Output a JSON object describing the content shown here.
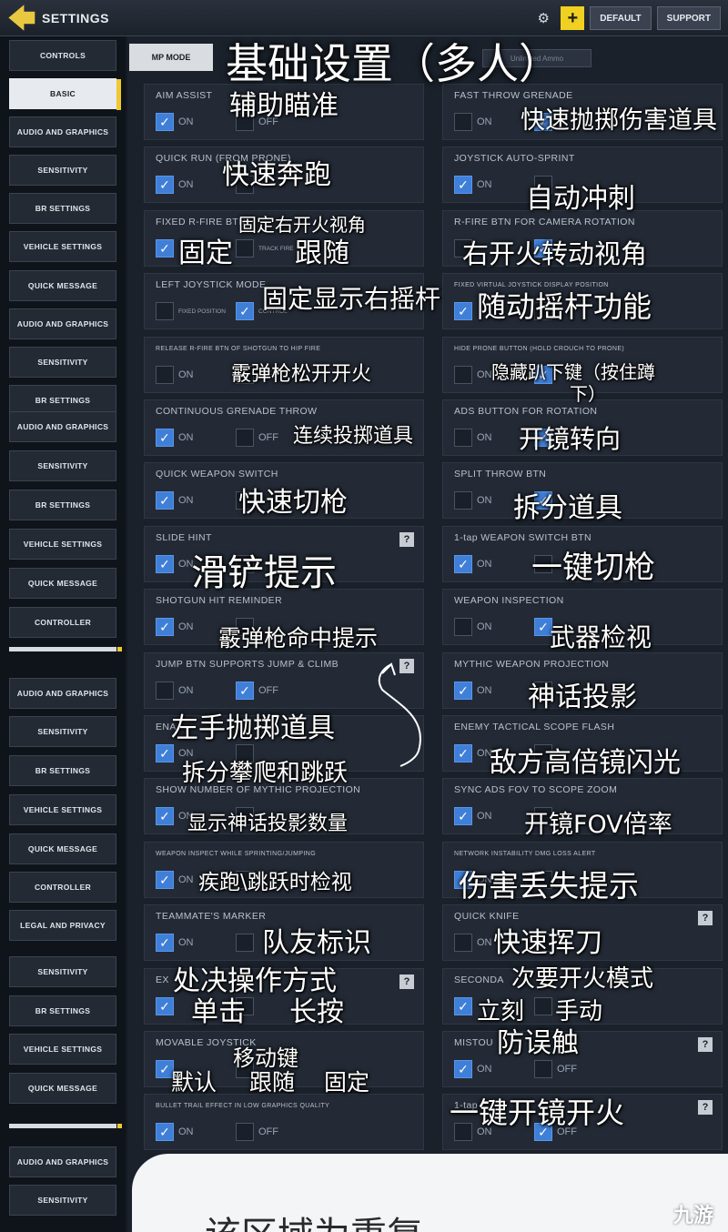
{
  "topbar": {
    "title": "SETTINGS",
    "default_label": "DEFAULT",
    "support_label": "SUPPORT",
    "gear_icon": "gear-icon",
    "plus_icon": "plus-icon"
  },
  "sidebar": {
    "items": [
      "CONTROLS",
      "BASIC",
      "AUDIO AND GRAPHICS",
      "SENSITIVITY",
      "BR SETTINGS",
      "VEHICLE SETTINGS",
      "QUICK MESSAGE",
      "AUDIO AND GRAPHICS",
      "SENSITIVITY",
      "BR SETTINGS",
      "AUDIO AND GRAPHICS",
      "SENSITIVITY",
      "BR SETTINGS",
      "VEHICLE SETTINGS",
      "QUICK MESSAGE",
      "CONTROLLER",
      "AUDIO AND GRAPHICS",
      "SENSITIVITY",
      "BR SETTINGS",
      "VEHICLE SETTINGS",
      "QUICK MESSAGE",
      "CONTROLLER",
      "LEGAL AND PRIVACY",
      "SENSITIVITY",
      "BR SETTINGS",
      "VEHICLE SETTINGS",
      "QUICK MESSAGE",
      "AUDIO AND GRAPHICS",
      "SENSITIVITY"
    ],
    "active_index": 1
  },
  "main": {
    "mode_tab": "MP MODE",
    "mode_label": "Unlimited Ammo"
  },
  "settings": {
    "left": [
      {
        "title": "AIM ASSIST",
        "opt1": "ON",
        "opt2": "OFF",
        "sel": 1
      },
      {
        "title": "QUICK RUN (FROM PRONE)",
        "opt1": "ON",
        "opt2": "",
        "sel": 1
      },
      {
        "title": "FIXED R-FIRE BTN",
        "opt1": "",
        "opt2": "TRACK FIRE",
        "sel": 1
      },
      {
        "title": "LEFT JOYSTICK MODE",
        "opt1": "FIXED POSITION",
        "opt2": "CONTROL",
        "sel": 2
      },
      {
        "title": "RELEASE R-FIRE BTN OF SHOTGUN TO HIP FIRE",
        "opt1": "ON",
        "opt2": "OFF",
        "sel": 0
      },
      {
        "title": "CONTINUOUS GRENADE THROW",
        "opt1": "ON",
        "opt2": "OFF",
        "sel": 1
      },
      {
        "title": "QUICK WEAPON SWITCH",
        "opt1": "ON",
        "opt2": "",
        "sel": 1
      },
      {
        "title": "SLIDE HINT",
        "opt1": "ON",
        "opt2": "",
        "sel": 1
      },
      {
        "title": "SHOTGUN HIT REMINDER",
        "opt1": "ON",
        "opt2": "",
        "sel": 1
      },
      {
        "title": "JUMP BTN SUPPORTS JUMP & CLIMB",
        "opt1": "ON",
        "opt2": "OFF",
        "sel": 2
      },
      {
        "title": "ENA",
        "opt1": "ON",
        "opt2": "",
        "sel": 1
      },
      {
        "title": "SHOW NUMBER OF MYTHIC PROJECTION",
        "opt1": "ON",
        "opt2": "",
        "sel": 1
      },
      {
        "title": "WEAPON INSPECT WHILE SPRINTING/JUMPING",
        "opt1": "ON",
        "opt2": "",
        "sel": 1
      },
      {
        "title": "TEAMMATE'S MARKER",
        "opt1": "ON",
        "opt2": "",
        "sel": 1
      },
      {
        "title": "EX",
        "opt1": "",
        "opt2": "",
        "sel": 1
      },
      {
        "title": "MOVABLE JOYSTICK",
        "opt1": "",
        "opt2": "",
        "sel": 1
      },
      {
        "title": "BULLET TRAIL EFFECT IN LOW GRAPHICS QUALITY",
        "opt1": "ON",
        "opt2": "OFF",
        "sel": 1
      }
    ],
    "right": [
      {
        "title": "FAST THROW GRENADE",
        "opt1": "ON",
        "opt2": "",
        "sel": 2
      },
      {
        "title": "JOYSTICK AUTO-SPRINT",
        "opt1": "ON",
        "opt2": "",
        "sel": 1
      },
      {
        "title": "R-FIRE BTN FOR CAMERA ROTATION",
        "opt1": "",
        "opt2": "",
        "sel": 2
      },
      {
        "title": "FIXED VIRTUAL JOYSTICK DISPLAY POSITION",
        "opt1": "",
        "opt2": "",
        "sel": 1
      },
      {
        "title": "HIDE PRONE BUTTON (HOLD CROUCH TO PRONE)",
        "opt1": "ON",
        "opt2": "",
        "sel": 2
      },
      {
        "title": "ADS BUTTON FOR ROTATION",
        "opt1": "ON",
        "opt2": "",
        "sel": 2
      },
      {
        "title": "SPLIT THROW BTN",
        "opt1": "ON",
        "opt2": "",
        "sel": 2
      },
      {
        "title": "1-tap WEAPON SWITCH BTN",
        "opt1": "ON",
        "opt2": "",
        "sel": 1
      },
      {
        "title": "WEAPON INSPECTION",
        "opt1": "ON",
        "opt2": "",
        "sel": 2
      },
      {
        "title": "MYTHIC WEAPON PROJECTION",
        "opt1": "ON",
        "opt2": "",
        "sel": 1
      },
      {
        "title": "ENEMY TACTICAL SCOPE FLASH",
        "opt1": "ON",
        "opt2": "",
        "sel": 1
      },
      {
        "title": "SYNC ADS FOV TO SCOPE ZOOM",
        "opt1": "ON",
        "opt2": "",
        "sel": 1
      },
      {
        "title": "NETWORK INSTABILITY DMG LOSS ALERT",
        "opt1": "ON",
        "opt2": "",
        "sel": 1
      },
      {
        "title": "QUICK KNIFE",
        "opt1": "ON",
        "opt2": "",
        "sel": 0
      },
      {
        "title": "SECONDA",
        "opt1": "",
        "opt2": "",
        "sel": 1
      },
      {
        "title": "MISTOU",
        "opt1": "ON",
        "opt2": "OFF",
        "sel": 1
      },
      {
        "title": "1-tap",
        "opt1": "ON",
        "opt2": "OFF",
        "sel": 2
      }
    ]
  },
  "annotations": {
    "title": "基础设置（多人）",
    "aim": "辅助瞄准",
    "fast_throw": "快速抛掷伤害道具",
    "quick_run": "快速奔跑",
    "auto_sprint": "自动冲刺",
    "fixed_rfire": "固定右开火视角",
    "fixed": "固定",
    "follow": "跟随",
    "rfire_rot": "右开火转动视角",
    "fixed_stick": "固定显示右摇杆",
    "float_stick": "随动摇杆功能",
    "shotgun_release": "霰弹枪松开开火",
    "hide_prone": "隐藏趴下键（按住蹲",
    "hide_prone2": "下）",
    "continuous": "连续投掷道具",
    "ads_rot": "开镜转向",
    "quick_switch": "快速切枪",
    "split": "拆分道具",
    "slide": "滑铲提示",
    "one_tap": "一键切枪",
    "shotgun_hit": "霰弹枪命中提示",
    "inspect": "武器检视",
    "mythic_proj": "神话投影",
    "left_throw": "左手抛掷道具",
    "enemy_flash": "敌方高倍镜闪光",
    "split_climb": "拆分攀爬和跳跃",
    "show_mythic": "显示神话投影数量",
    "fov": "开镜FOV倍率",
    "sprint_inspect": "疾跑\\跳跃时检视",
    "dmg_loss": "伤害丢失提示",
    "teammate": "队友标识",
    "quick_knife": "快速挥刀",
    "exec_mode": "处决操作方式",
    "secondary": "次要开火模式",
    "tap": "单击",
    "hold": "长按",
    "instant": "立刻",
    "manual": "手动",
    "mistouch": "防误触",
    "movable": "移动键",
    "default": "默认",
    "follow2": "跟随",
    "fixed2": "固定",
    "one_tap_ads": "一键开镜开火",
    "bottom": "该区域为重复",
    "watermark": "九游"
  }
}
